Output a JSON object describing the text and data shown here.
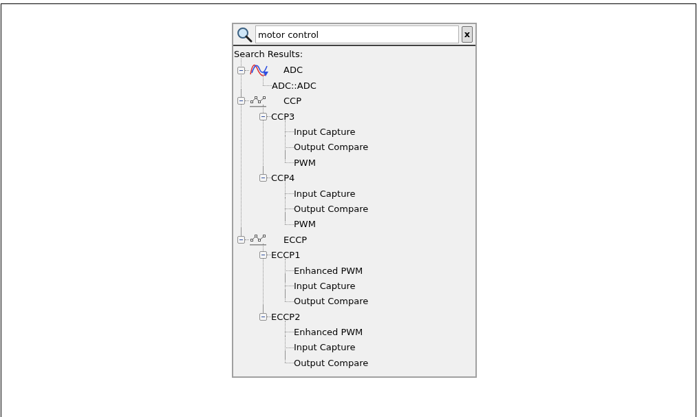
{
  "search": {
    "value": "motor control",
    "clear_button": "x"
  },
  "results_label": "Search Results:",
  "results": [
    {
      "label": "ADC",
      "kind": "wave",
      "expanded": true,
      "children": [
        {
          "label": "ADC::ADC"
        }
      ]
    },
    {
      "label": "CCP",
      "kind": "pulse",
      "expanded": true,
      "children": [
        {
          "label": "CCP3",
          "expanded": true,
          "children": [
            {
              "label": "Input Capture"
            },
            {
              "label": "Output Compare"
            },
            {
              "label": "PWM"
            }
          ]
        },
        {
          "label": "CCP4",
          "expanded": true,
          "children": [
            {
              "label": "Input Capture"
            },
            {
              "label": "Output Compare"
            },
            {
              "label": "PWM"
            }
          ]
        }
      ]
    },
    {
      "label": "ECCP",
      "kind": "pulse",
      "expanded": true,
      "children": [
        {
          "label": "ECCP1",
          "expanded": true,
          "children": [
            {
              "label": "Enhanced PWM"
            },
            {
              "label": "Input Capture"
            },
            {
              "label": "Output Compare"
            }
          ]
        },
        {
          "label": "ECCP2",
          "expanded": true,
          "children": [
            {
              "label": "Enhanced PWM"
            },
            {
              "label": "Input Capture"
            },
            {
              "label": "Output Compare"
            }
          ]
        }
      ]
    }
  ]
}
